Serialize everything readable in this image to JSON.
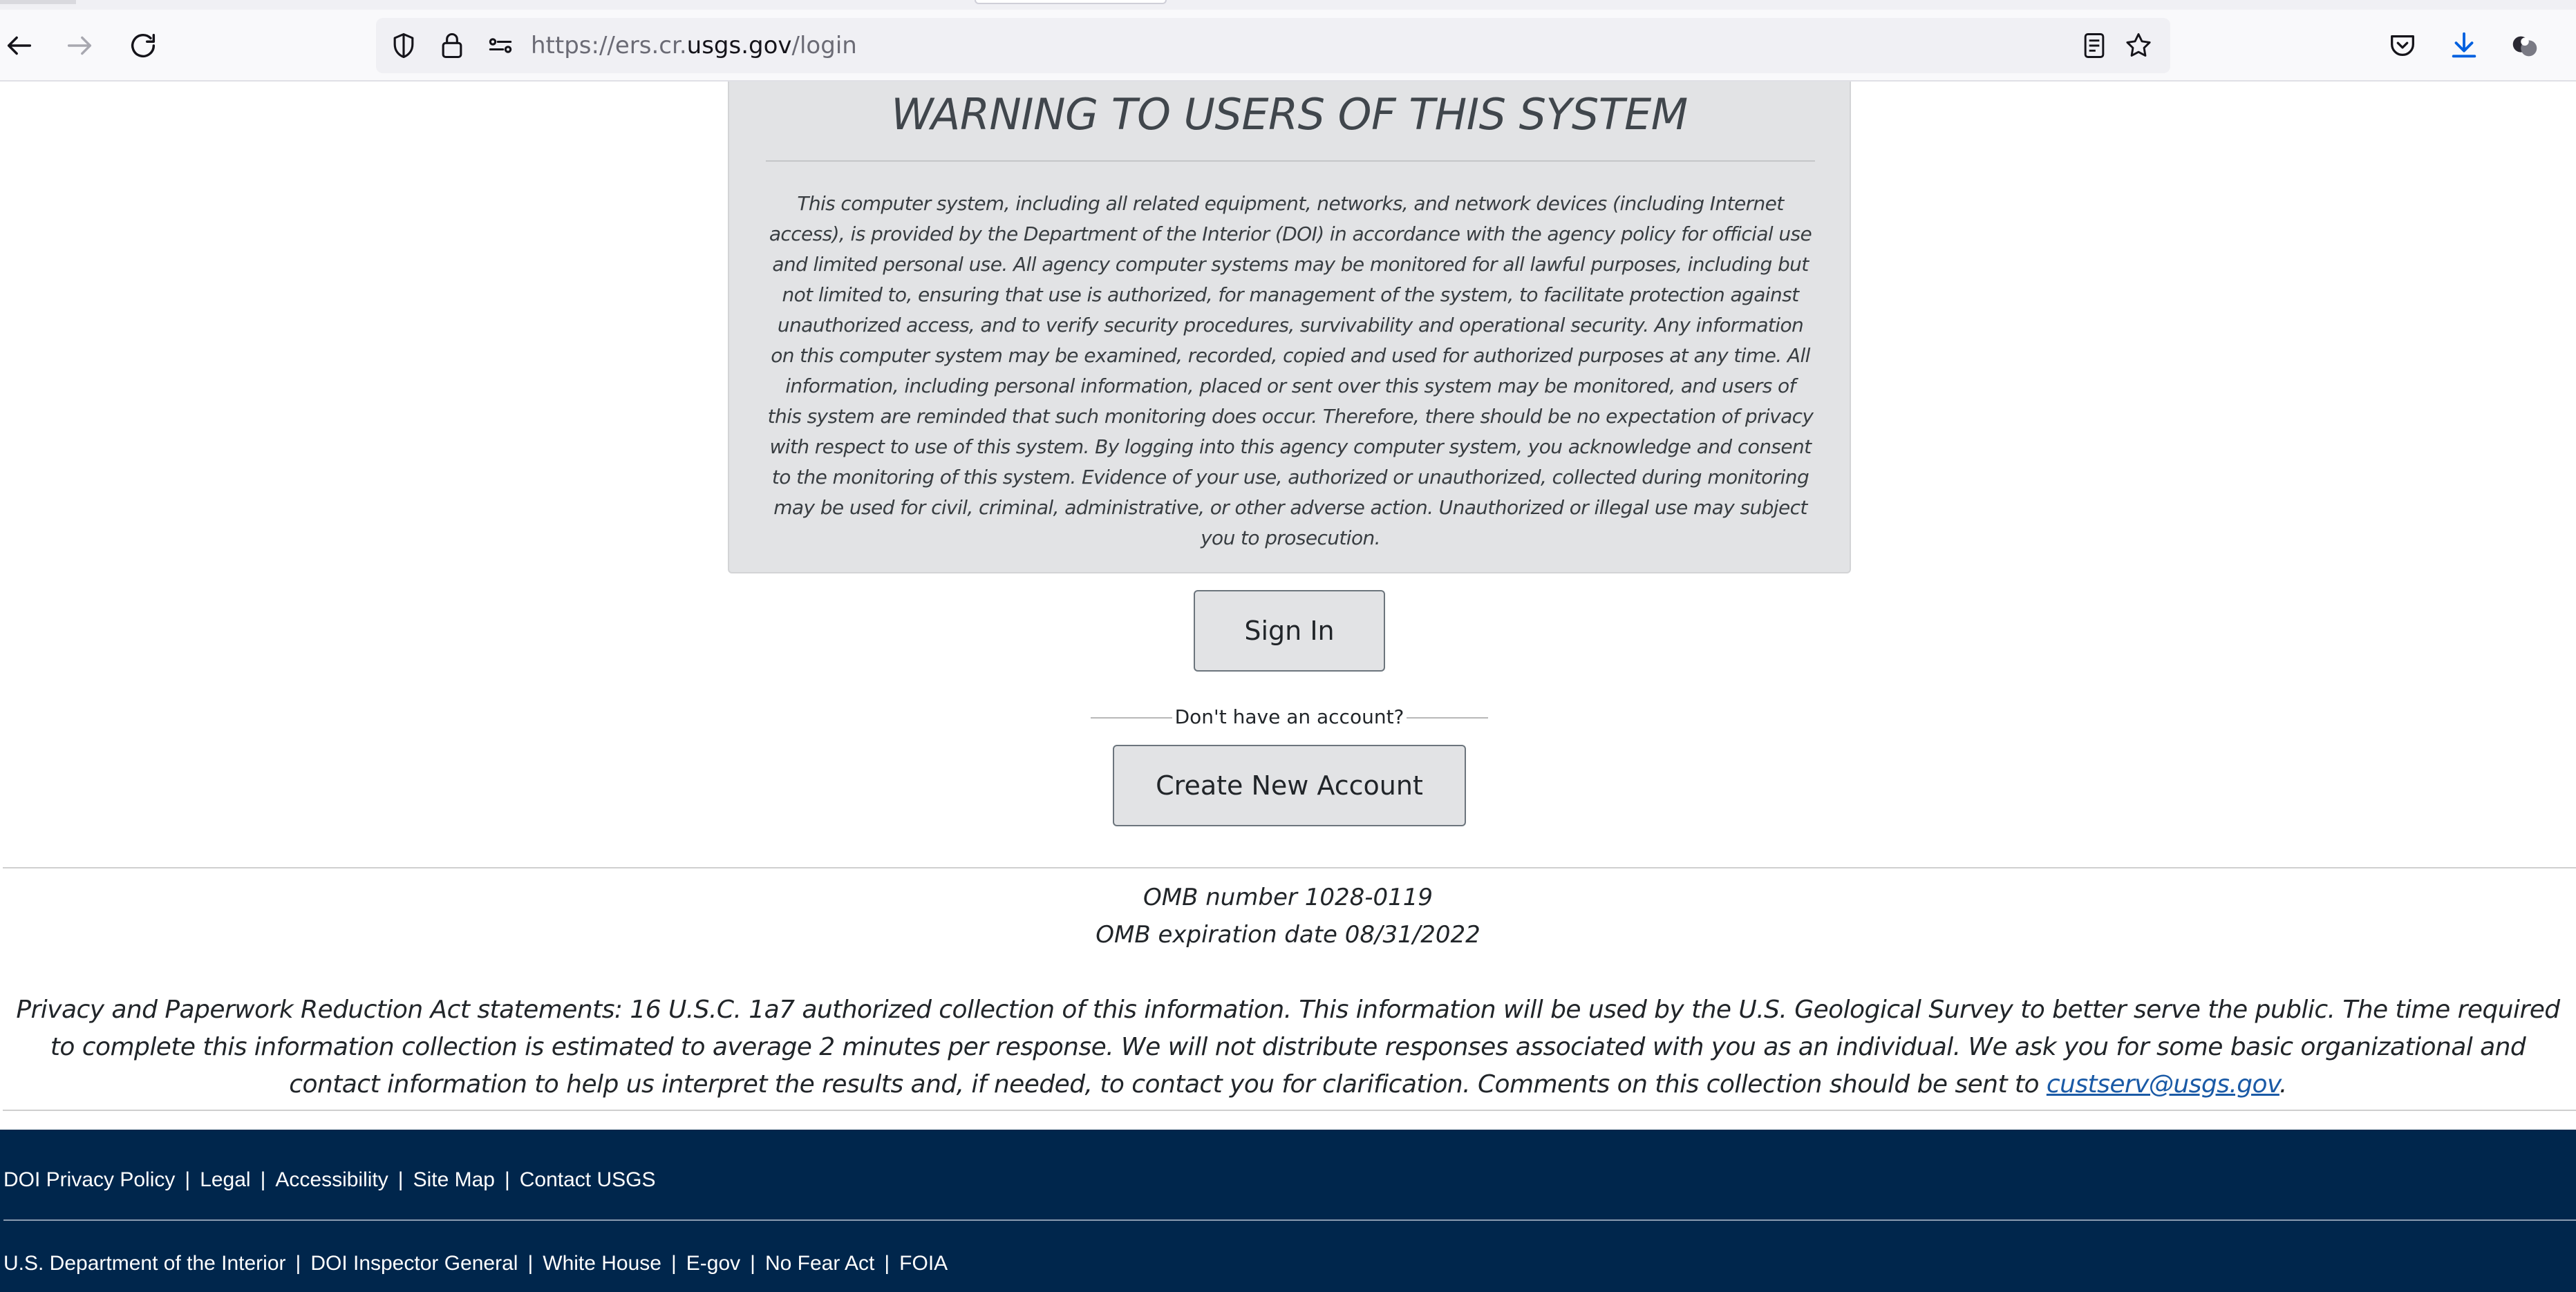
{
  "browser": {
    "url_prefix": "https://ers.cr.",
    "url_domain": "usgs.gov",
    "url_path": "/login",
    "icons": [
      "back-arrow-icon",
      "forward-arrow-icon",
      "reload-icon",
      "shield-icon",
      "lock-icon",
      "permissions-icon",
      "reader-view-icon",
      "bookmark-star-icon",
      "pocket-icon",
      "download-icon",
      "extensions-icon"
    ]
  },
  "warning": {
    "title": "WARNING TO USERS OF THIS SYSTEM",
    "body": "This computer system, including all related equipment, networks, and network devices (including Internet access), is provided by the Department of the Interior (DOI) in accordance with the agency policy for official use and limited personal use. All agency computer systems may be monitored for all lawful purposes, including but not limited to, ensuring that use is authorized, for management of the system, to facilitate protection against unauthorized access, and to verify security procedures, survivability and operational security. Any information on this computer system may be examined, recorded, copied and used for authorized purposes at any time. All information, including personal information, placed or sent over this system may be monitored, and users of this system are reminded that such monitoring does occur. Therefore, there should be no expectation of privacy with respect to use of this system. By logging into this agency computer system, you acknowledge and consent to the monitoring of this system. Evidence of your use, authorized or unauthorized, collected during monitoring may be used for civil, criminal, administrative, or other adverse action. Unauthorized or illegal use may subject you to prosecution."
  },
  "auth": {
    "sign_in_label": "Sign In",
    "no_account_text": "Don't have an account?",
    "create_account_label": "Create New Account"
  },
  "omb": {
    "number": "OMB number 1028-0119",
    "expiration": "OMB expiration date 08/31/2022"
  },
  "privacy": {
    "statement": "Privacy and Paperwork Reduction Act statements: 16 U.S.C. 1a7 authorized collection of this information. This information will be used by the U.S. Geological Survey to better serve the public. The time required to complete this information collection is estimated to average 2 minutes per response. We will not distribute responses associated with you as an individual. We ask you for some basic organizational and contact information to help us interpret the results and, if needed, to contact you for clarification. Comments on this collection should be sent to ",
    "email": "custserv@usgs.gov",
    "end": "."
  },
  "footer": {
    "row1": [
      {
        "label": "DOI Privacy Policy"
      },
      {
        "label": "Legal"
      },
      {
        "label": "Accessibility"
      },
      {
        "label": "Site Map"
      },
      {
        "label": "Contact USGS"
      }
    ],
    "row2": [
      {
        "label": "U.S. Department of the Interior"
      },
      {
        "label": "DOI Inspector General"
      },
      {
        "label": "White House"
      },
      {
        "label": "E-gov"
      },
      {
        "label": "No Fear Act"
      },
      {
        "label": "FOIA"
      }
    ],
    "separator": "|"
  },
  "colors": {
    "footer_bg": "#00264c",
    "warning_bg": "#e2e3e5",
    "link": "#1a5aa6",
    "download_icon": "#0060df"
  }
}
